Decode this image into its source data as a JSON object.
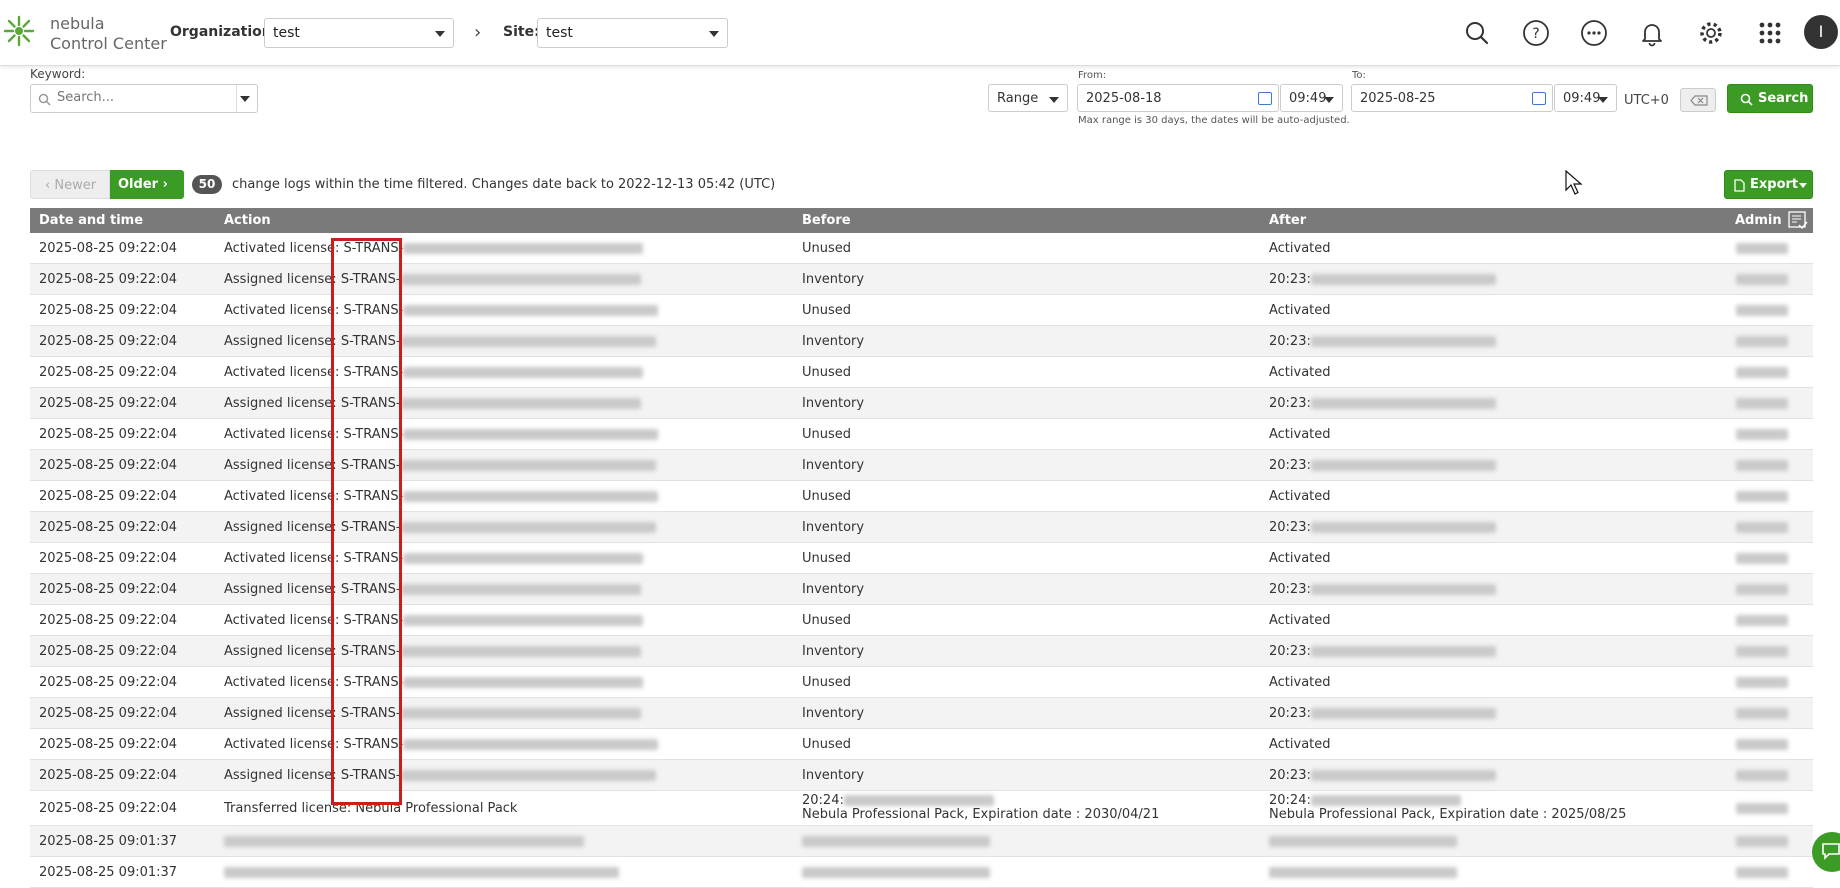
{
  "brand": {
    "line1": "nebula",
    "line2": "Control Center"
  },
  "org": {
    "label": "Organization:",
    "value": "test"
  },
  "site": {
    "label": "Site:",
    "value": "test"
  },
  "keyword": {
    "label": "Keyword:",
    "placeholder": "Search..."
  },
  "range": {
    "mode": "Range",
    "from_label": "From:",
    "from_date": "2025-08-18",
    "from_time": "09:49",
    "to_label": "To:",
    "to_date": "2025-08-25",
    "to_time": "09:49",
    "tz": "UTC+0",
    "note": "Max range is 30 days, the dates will be auto-adjusted."
  },
  "search_label": "Search",
  "pager": {
    "newer": "Newer",
    "older": "Older",
    "count": "50",
    "message": "change logs within the time filtered. Changes date back to 2022-12-13 05:42 (UTC)"
  },
  "export_label": "Export",
  "columns": {
    "date": "Date and time",
    "action": "Action",
    "before": "Before",
    "after": "After",
    "admin": "Admin"
  },
  "rows": [
    {
      "date": "2025-08-25 09:22:04",
      "action": "Activated license: S-TRANS-",
      "before": "Unused",
      "after": "Activated"
    },
    {
      "date": "2025-08-25 09:22:04",
      "action": "Assigned license: S-TRANS-",
      "before": "Inventory",
      "after": "20:23:"
    },
    {
      "date": "2025-08-25 09:22:04",
      "action": "Activated license: S-TRANS-",
      "before": "Unused",
      "after": "Activated"
    },
    {
      "date": "2025-08-25 09:22:04",
      "action": "Assigned license: S-TRANS-",
      "before": "Inventory",
      "after": "20:23:"
    },
    {
      "date": "2025-08-25 09:22:04",
      "action": "Activated license: S-TRANS-",
      "before": "Unused",
      "after": "Activated"
    },
    {
      "date": "2025-08-25 09:22:04",
      "action": "Assigned license: S-TRANS-",
      "before": "Inventory",
      "after": "20:23:"
    },
    {
      "date": "2025-08-25 09:22:04",
      "action": "Activated license: S-TRANS-",
      "before": "Unused",
      "after": "Activated"
    },
    {
      "date": "2025-08-25 09:22:04",
      "action": "Assigned license: S-TRANS-",
      "before": "Inventory",
      "after": "20:23:"
    },
    {
      "date": "2025-08-25 09:22:04",
      "action": "Activated license: S-TRANS-",
      "before": "Unused",
      "after": "Activated"
    },
    {
      "date": "2025-08-25 09:22:04",
      "action": "Assigned license: S-TRANS-",
      "before": "Inventory",
      "after": "20:23:"
    },
    {
      "date": "2025-08-25 09:22:04",
      "action": "Activated license: S-TRANS-",
      "before": "Unused",
      "after": "Activated"
    },
    {
      "date": "2025-08-25 09:22:04",
      "action": "Assigned license: S-TRANS-",
      "before": "Inventory",
      "after": "20:23:"
    },
    {
      "date": "2025-08-25 09:22:04",
      "action": "Activated license: S-TRANS-",
      "before": "Unused",
      "after": "Activated"
    },
    {
      "date": "2025-08-25 09:22:04",
      "action": "Assigned license: S-TRANS-",
      "before": "Inventory",
      "after": "20:23:"
    },
    {
      "date": "2025-08-25 09:22:04",
      "action": "Activated license: S-TRANS-",
      "before": "Unused",
      "after": "Activated"
    },
    {
      "date": "2025-08-25 09:22:04",
      "action": "Assigned license: S-TRANS-",
      "before": "Inventory",
      "after": "20:23:"
    },
    {
      "date": "2025-08-25 09:22:04",
      "action": "Activated license: S-TRANS-",
      "before": "Unused",
      "after": "Activated"
    },
    {
      "date": "2025-08-25 09:22:04",
      "action": "Assigned license: S-TRANS-",
      "before": "Inventory",
      "after": "20:23:"
    }
  ],
  "transfer_row": {
    "date": "2025-08-25 09:22:04",
    "action": "Transferred license: Nebula Professional Pack",
    "before_1": "20:24:",
    "before_2": "Nebula Professional Pack, Expiration date : 2030/04/21",
    "after_1": "20:24:",
    "after_2": "Nebula Professional Pack, Expiration date : 2025/08/25"
  },
  "tail_rows": [
    {
      "date": "2025-08-25 09:01:37"
    },
    {
      "date": "2025-08-25 09:01:37"
    }
  ],
  "colors": {
    "accent": "#3b9b24",
    "header": "#7a7a7a",
    "highlight": "#c81e1e"
  }
}
